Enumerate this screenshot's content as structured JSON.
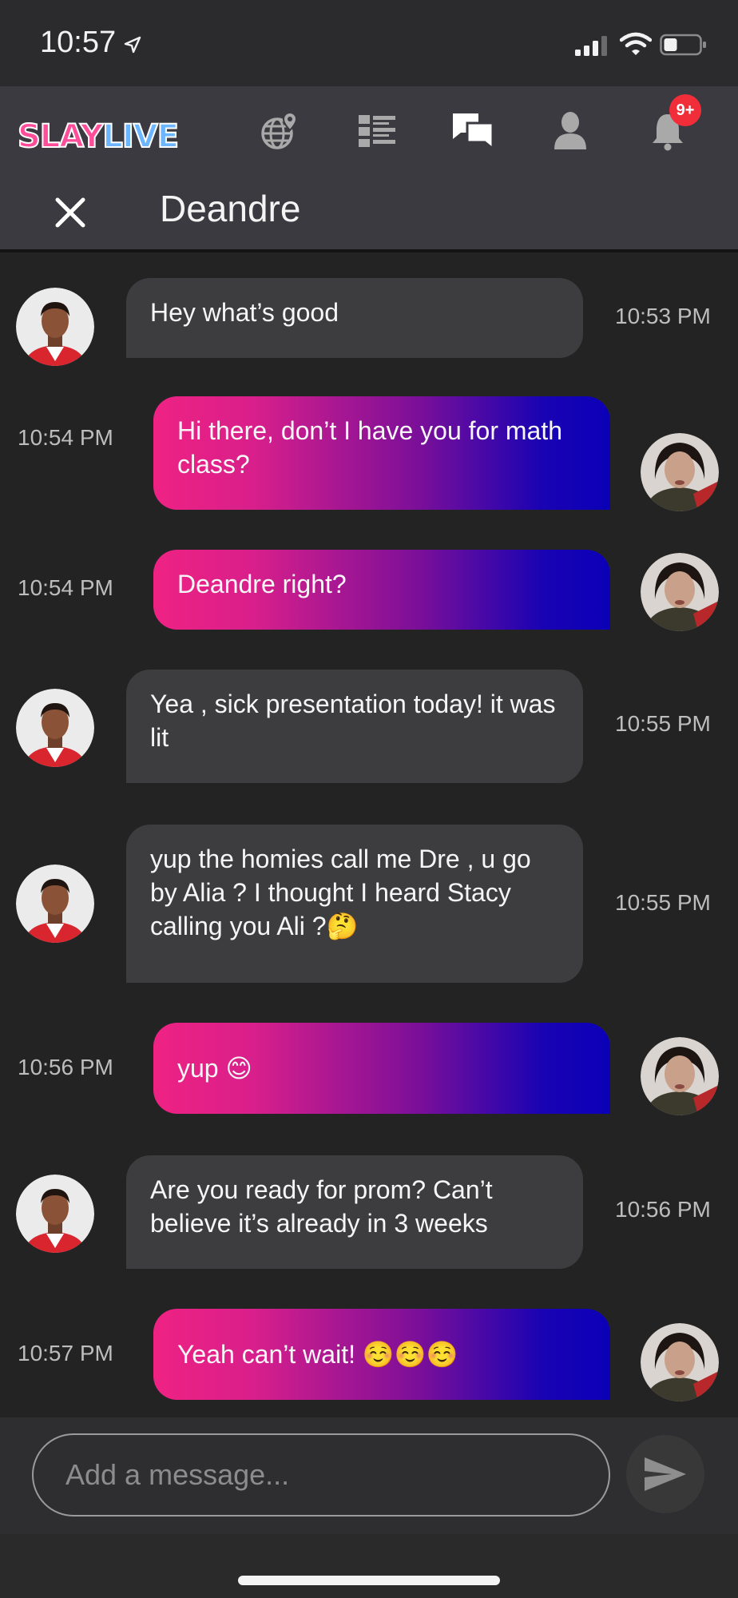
{
  "status_bar": {
    "time": "10:57"
  },
  "nav": {
    "logo_part1": "SLAY",
    "logo_part2": "LIVE",
    "notification_badge": "9+",
    "icons": [
      "globe-icon",
      "list-icon",
      "chat-icon",
      "profile-icon",
      "bell-icon"
    ]
  },
  "chat": {
    "title": "Deandre"
  },
  "messages": [
    {
      "direction": "in",
      "text": "Hey what’s good",
      "time": "10:53 PM"
    },
    {
      "direction": "out",
      "text": "Hi there, don’t I have you for math class?",
      "time": "10:54 PM"
    },
    {
      "direction": "out",
      "text": "Deandre right?",
      "time": "10:54 PM"
    },
    {
      "direction": "in",
      "text": "Yea , sick presentation today! it was lit",
      "time": "10:55 PM"
    },
    {
      "direction": "in",
      "text": "yup the homies call me Dre , u go by Alia ? I thought I heard Stacy calling you Ali ?🤔",
      "time": "10:55 PM"
    },
    {
      "direction": "out",
      "text": "yup 😊",
      "time": "10:56 PM"
    },
    {
      "direction": "in",
      "text": "Are you ready for prom? Can’t believe it’s already in 3 weeks",
      "time": "10:56 PM"
    },
    {
      "direction": "out",
      "text": "Yeah can’t wait! ☺️☺️☺️",
      "time": "10:57 PM"
    }
  ],
  "composer": {
    "placeholder": "Add a message..."
  },
  "colors": {
    "gradient_start": "#ef2283",
    "gradient_end": "#0b00b7",
    "badge": "#f22d3a"
  }
}
